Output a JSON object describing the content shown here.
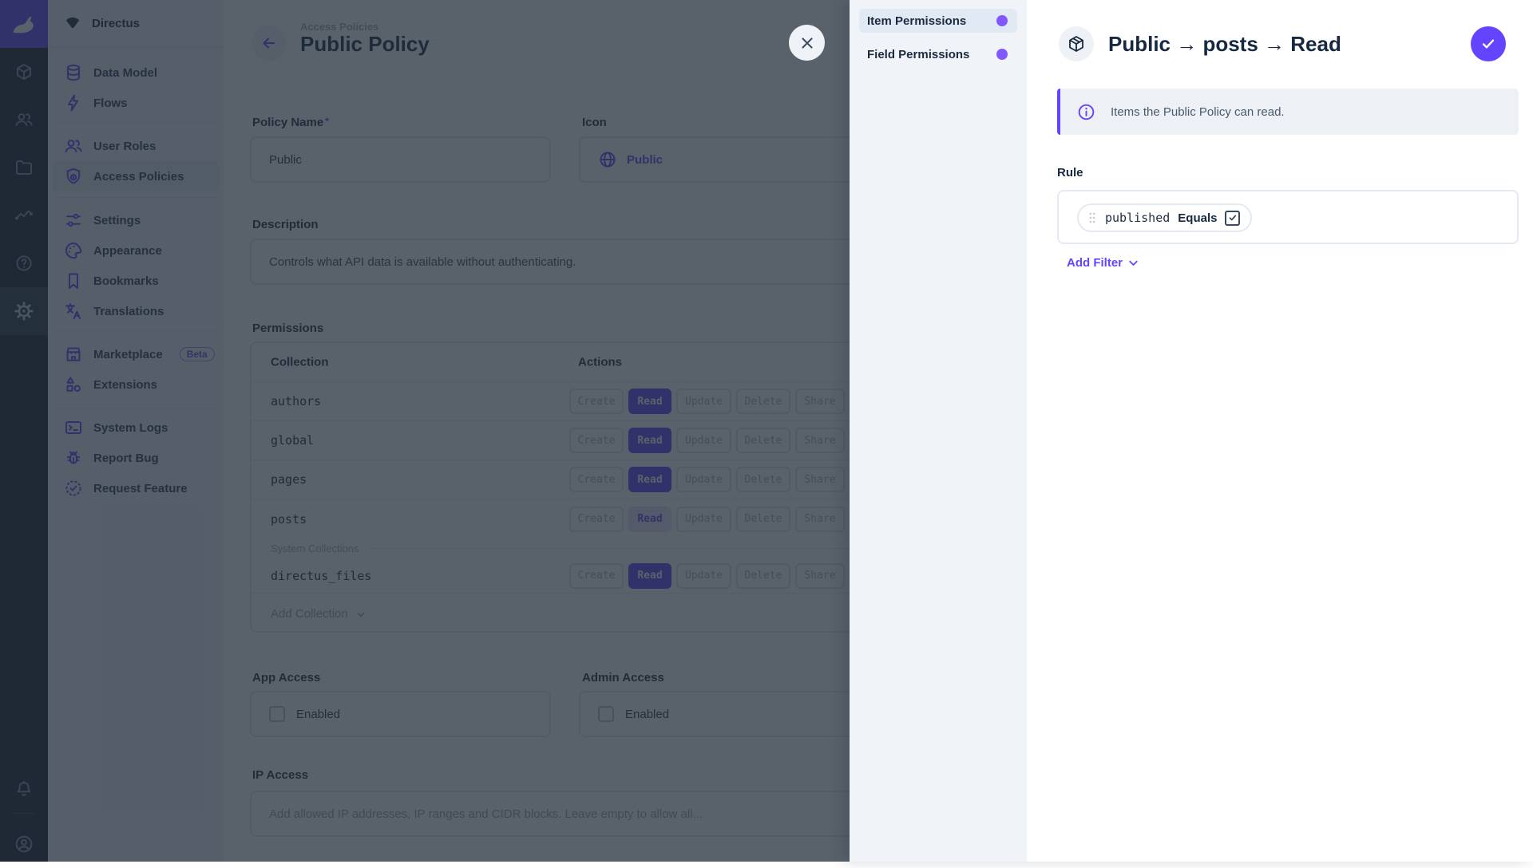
{
  "module_bar": {
    "modules": [
      {
        "name": "content"
      },
      {
        "name": "user-directory"
      },
      {
        "name": "file-library"
      },
      {
        "name": "insights"
      },
      {
        "name": "documentation"
      },
      {
        "name": "settings",
        "active": true
      }
    ]
  },
  "sidebar": {
    "project_name": "Directus",
    "items": [
      {
        "label": "Data Model"
      },
      {
        "label": "Flows"
      },
      {
        "label": "User Roles"
      },
      {
        "label": "Access Policies",
        "active": true
      },
      {
        "label": "Settings"
      },
      {
        "label": "Appearance"
      },
      {
        "label": "Bookmarks"
      },
      {
        "label": "Translations"
      },
      {
        "label": "Marketplace",
        "badge": "Beta"
      },
      {
        "label": "Extensions"
      },
      {
        "label": "System Logs"
      },
      {
        "label": "Report Bug"
      },
      {
        "label": "Request Feature"
      }
    ]
  },
  "main": {
    "breadcrumb": "Access Policies",
    "title": "Public Policy",
    "fields": {
      "policy_name": {
        "label": "Policy Name",
        "required_mark": "*",
        "value": "Public"
      },
      "icon": {
        "label": "Icon",
        "value": "Public"
      },
      "description": {
        "label": "Description",
        "value": "Controls what API data is available without authenticating."
      },
      "app_access": {
        "label": "App Access",
        "checkbox_label": "Enabled",
        "checked": false
      },
      "admin_access": {
        "label": "Admin Access",
        "checkbox_label": "Enabled",
        "checked": false
      },
      "ip_access": {
        "label": "IP Access",
        "placeholder": "Add allowed IP addresses, IP ranges and CIDR blocks. Leave empty to allow all..."
      }
    },
    "permissions": {
      "label": "Permissions",
      "columns": {
        "collection": "Collection",
        "actions": "Actions"
      },
      "actions": [
        "Create",
        "Read",
        "Update",
        "Delete",
        "Share"
      ],
      "rows": [
        {
          "collection": "authors",
          "read_state": "solid"
        },
        {
          "collection": "global",
          "read_state": "solid"
        },
        {
          "collection": "pages",
          "read_state": "solid"
        },
        {
          "collection": "posts",
          "read_state": "soft"
        }
      ],
      "system_divider": "System Collections",
      "system_rows": [
        {
          "collection": "directus_files",
          "read_state": "solid"
        }
      ],
      "add_collection": "Add Collection"
    }
  },
  "drawer": {
    "nav": [
      {
        "label": "Item Permissions",
        "active": true
      },
      {
        "label": "Field Permissions"
      }
    ],
    "title": "Public → posts → Read",
    "notice": "Items the Public Policy can read.",
    "rule_label": "Rule",
    "filter": {
      "field": "published",
      "operator": "Equals",
      "value_checked": true
    },
    "add_filter": "Add Filter"
  },
  "colors": {
    "primary": "#6644ff",
    "navy": "#172940",
    "overlay": "rgba(33,44,56,0.75)"
  }
}
